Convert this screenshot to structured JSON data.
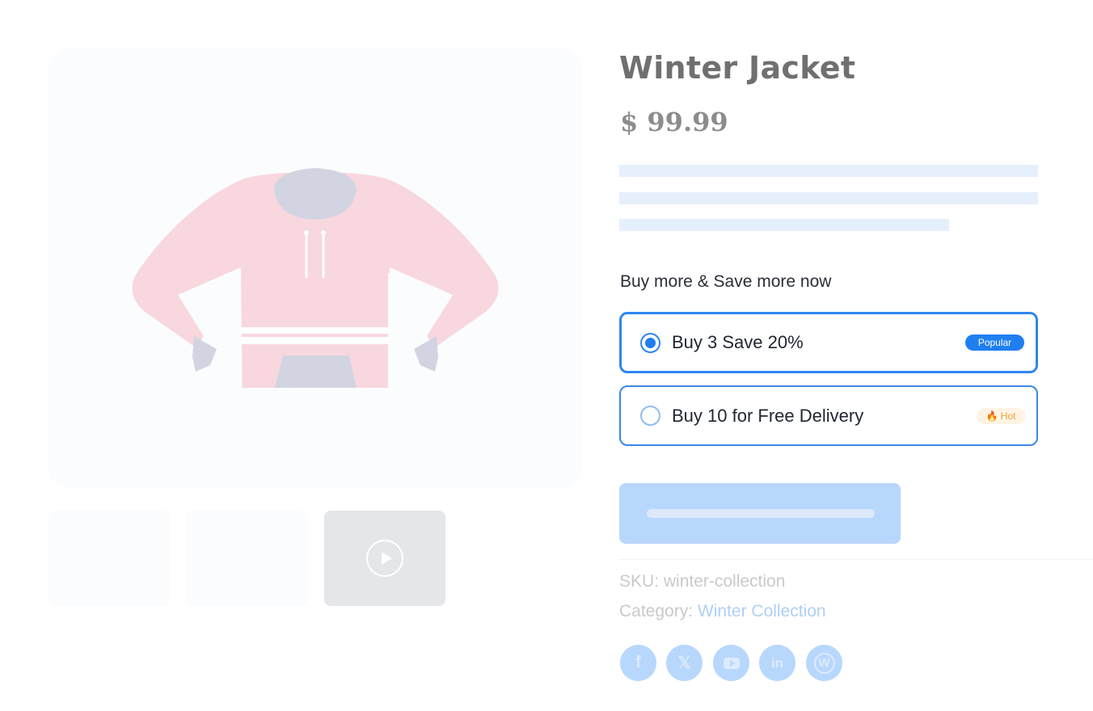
{
  "product": {
    "title": "Winter Jacket",
    "price": "$ 99.99"
  },
  "offers": {
    "heading": "Buy more & Save more now",
    "items": [
      {
        "label": "Buy 3 Save 20%",
        "badge": "Popular",
        "selected": true
      },
      {
        "label": "Buy 10 for Free Delivery",
        "badge": "🔥 Hot",
        "selected": false
      }
    ]
  },
  "meta": {
    "sku_label": "SKU:",
    "sku_value": "winter-collection",
    "category_label": "Category:",
    "category_value": "Winter Collection"
  },
  "social": {
    "icons": [
      "facebook-icon",
      "x-icon",
      "youtube-icon",
      "linkedin-icon",
      "wordpress-icon"
    ],
    "facebook_glyph": "f",
    "x_glyph": "𝕏",
    "linkedin_glyph": "in",
    "wordpress_glyph": "W"
  },
  "colors": {
    "accent": "#1f7ff1",
    "hoodie_body": "#f8d7de",
    "hoodie_trim": "#d2d4e1",
    "cart_button": "#b8d7fc"
  }
}
